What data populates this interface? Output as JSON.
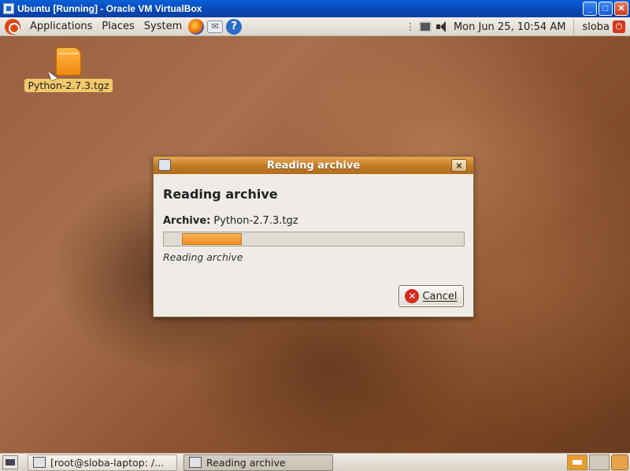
{
  "vbox_window": {
    "title": "Ubuntu [Running] - Oracle VM VirtualBox",
    "controls": {
      "minimize": "_",
      "maximize": "□",
      "close": "✕"
    }
  },
  "top_panel": {
    "menus": [
      "Applications",
      "Places",
      "System"
    ],
    "launchers": [
      "firefox-icon",
      "mail-icon",
      "help-icon"
    ],
    "help_glyph": "?",
    "clock": "Mon Jun 25, 10:54 AM",
    "user": "sloba",
    "power_glyph": "⏻"
  },
  "desktop": {
    "icon_label": "Python-2.7.3.tgz"
  },
  "dialog": {
    "title": "Reading archive",
    "close_glyph": "✕",
    "heading": "Reading archive",
    "archive_label": "Archive:",
    "archive_value": "Python-2.7.3.tgz",
    "progress_pulse_start": 0.06,
    "progress_pulse_width": 0.2,
    "status": "Reading archive",
    "cancel_glyph": "✕",
    "cancel_label": "Cancel"
  },
  "bottom_panel": {
    "tasks": [
      "[root@sloba-laptop: /...",
      "Reading archive"
    ],
    "active_task": 1
  },
  "colors": {
    "accent_orange": "#f08c1e",
    "title_orange": "#c07a26",
    "xp_blue": "#0747b4",
    "ubuntu_red": "#dd4814"
  }
}
